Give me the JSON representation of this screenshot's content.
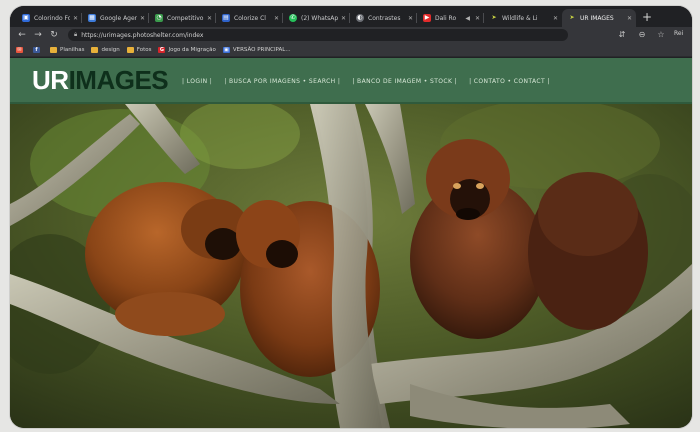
{
  "tabs": [
    {
      "label": "Colorindo Fot",
      "fav_color": "#2f6ad8",
      "fav_glyph": "▣",
      "fav_icon": "picture-icon",
      "active": false
    },
    {
      "label": "Google Agen",
      "fav_color": "#3d7bd9",
      "fav_glyph": "▦",
      "fav_icon": "calendar-icon",
      "active": false
    },
    {
      "label": "Competitivo",
      "fav_color": "#3a9a4c",
      "fav_glyph": "◔",
      "fav_icon": "chart-icon",
      "active": false
    },
    {
      "label": "Colorize Cl",
      "fav_color": "#2e62c9",
      "fav_glyph": "▤",
      "fav_icon": "doc-icon",
      "active": false
    },
    {
      "label": "(2) WhatsApp",
      "fav_color": "#25c05a",
      "fav_glyph": "✆",
      "fav_icon": "whatsapp-icon",
      "active": false
    },
    {
      "label": "Contrastes",
      "fav_color": "#6c6f75",
      "fav_glyph": "◐",
      "fav_icon": "contrast-icon",
      "active": false
    },
    {
      "label": "Dali Ro",
      "fav_color": "#e22b2b",
      "fav_glyph": "▶",
      "fav_icon": "youtube-icon",
      "active": false
    },
    {
      "label": "Wildlife & Li",
      "fav_color": "#c7d142",
      "fav_glyph": "➤",
      "fav_icon": "arrow-icon",
      "active": false
    },
    {
      "label": "UR IMAGES",
      "fav_color": "#c7d142",
      "fav_glyph": "➤",
      "fav_icon": "arrow-icon",
      "active": true
    }
  ],
  "address": {
    "url": "https://urimages.photoshelter.com/index"
  },
  "profile_label": "Rei",
  "bookmarks": [
    {
      "label": "",
      "icon_color": "#e8553d",
      "glyph": "✉",
      "icon": "gmail-icon"
    },
    {
      "label": "",
      "icon_color": "#3b5998",
      "glyph": "f",
      "icon": "facebook-icon"
    },
    {
      "label": "Planilhas",
      "icon_color": "#e8b13a",
      "glyph": "",
      "icon": "folder-icon"
    },
    {
      "label": "design",
      "icon_color": "#e8b13a",
      "glyph": "",
      "icon": "folder-icon"
    },
    {
      "label": "Fotos",
      "icon_color": "#e8b13a",
      "glyph": "",
      "icon": "folder-icon"
    },
    {
      "label": "Jogo da Migração",
      "icon_color": "#d6262c",
      "glyph": "G",
      "icon": "game-icon"
    },
    {
      "label": "VERSÃO PRINCIPAL...",
      "icon_color": "#3b6fd8",
      "glyph": "▣",
      "icon": "doc-icon"
    }
  ],
  "site": {
    "logo_part1": "UR",
    "logo_part2": "IMAGES",
    "nav": [
      "| LOGIN |",
      "| BUSCA POR IMAGENS • SEARCH |",
      "| BANCO DE IMAGEM • STOCK |",
      "| CONTATO • CONTACT |"
    ],
    "brand_color": "#3f6e4e"
  },
  "photo": {
    "subject": "howler-monkeys-on-branch"
  }
}
